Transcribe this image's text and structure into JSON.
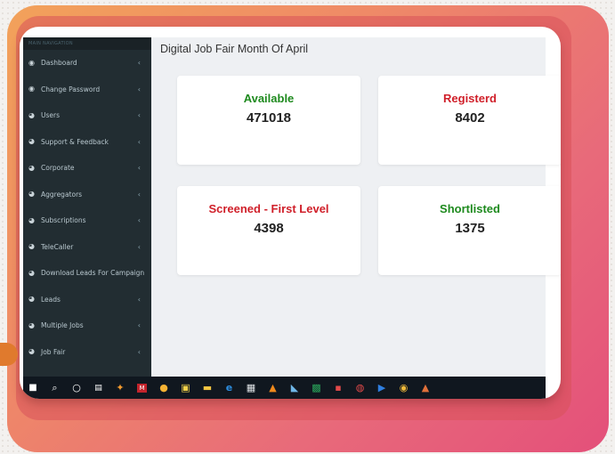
{
  "sidebar": {
    "header": "MAIN NAVIGATION",
    "items": [
      {
        "label": "Dashboard",
        "icon": "dashboard-icon"
      },
      {
        "label": "Change Password",
        "icon": "dashboard-icon"
      },
      {
        "label": "Users",
        "icon": "pie-icon"
      },
      {
        "label": "Support & Feedback",
        "icon": "pie-icon"
      },
      {
        "label": "Corporate",
        "icon": "pie-icon"
      },
      {
        "label": "Aggregators",
        "icon": "pie-icon"
      },
      {
        "label": "Subscriptions",
        "icon": "pie-icon"
      },
      {
        "label": "TeleCaller",
        "icon": "pie-icon"
      },
      {
        "label": "Download Leads For Campaign",
        "icon": "pie-icon"
      },
      {
        "label": "Leads",
        "icon": "pie-icon"
      },
      {
        "label": "Multiple Jobs",
        "icon": "pie-icon"
      },
      {
        "label": "Job Fair",
        "icon": "pie-icon"
      }
    ],
    "chevron": "‹"
  },
  "main": {
    "title": "Digital Job Fair Month Of April",
    "cards": [
      {
        "label": "Available",
        "value": "471018",
        "color": "#1e8a1e"
      },
      {
        "label": "Registerd",
        "value": "8402",
        "color": "#d0202a"
      },
      {
        "label": "Screened - First Level",
        "value": "4398",
        "color": "#d0202a"
      },
      {
        "label": "Shortlisted",
        "value": "1375",
        "color": "#1e8a1e"
      }
    ]
  },
  "taskbar": {
    "icons": [
      "windows-start-icon",
      "search-icon",
      "cortana-icon",
      "task-view-icon",
      "app-icon",
      "app-icon",
      "app-icon",
      "store-icon",
      "file-explorer-icon",
      "edge-icon",
      "app-icon",
      "vlc-icon",
      "app-icon",
      "excel-icon",
      "app-icon",
      "app-icon",
      "app-icon",
      "chrome-icon",
      "app-icon"
    ]
  }
}
